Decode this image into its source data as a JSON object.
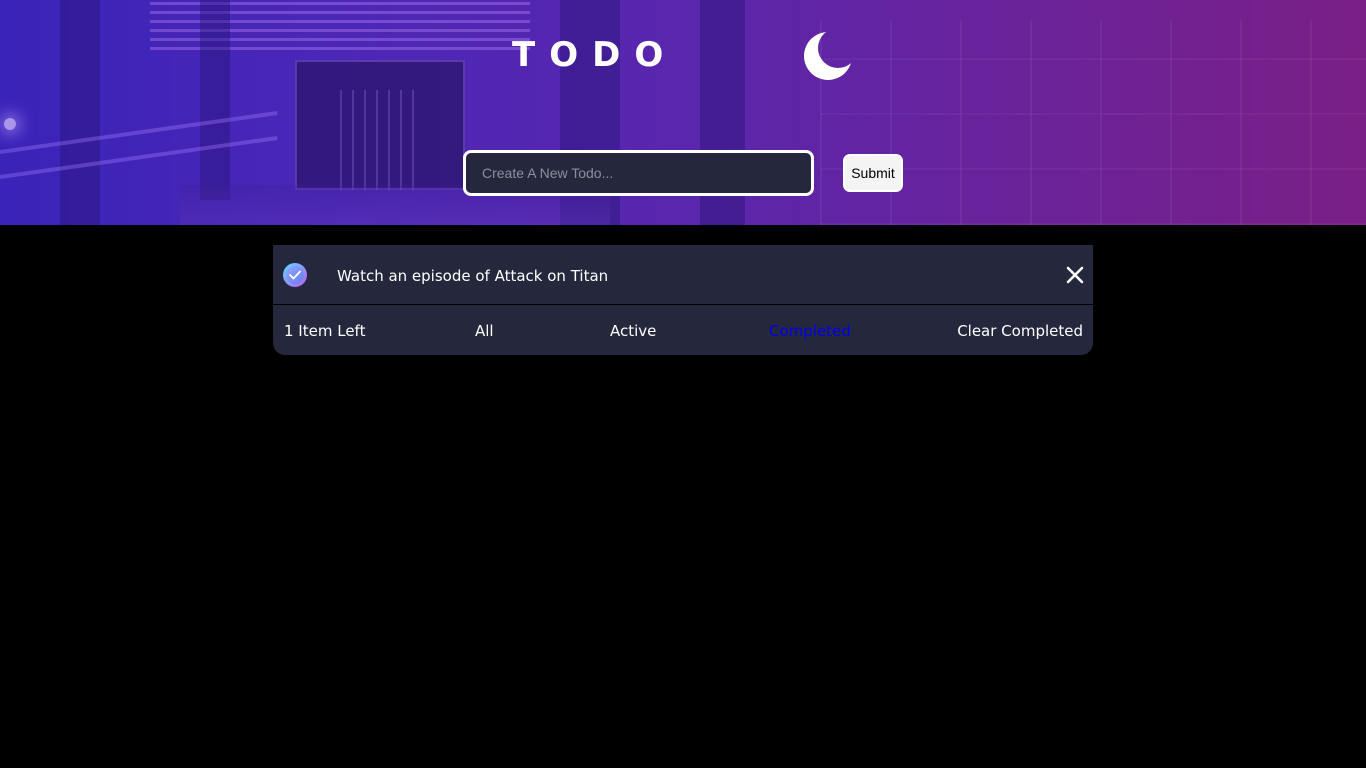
{
  "header": {
    "title": "TODO",
    "theme_toggle_icon": "moon-icon"
  },
  "new_todo": {
    "placeholder": "Create A New Todo...",
    "value": "",
    "submit_label": "Submit"
  },
  "todos": [
    {
      "text": "Watch an episode of Attack on Titan",
      "completed": true,
      "check_icon": "check-circle-icon",
      "delete_icon": "close-icon"
    }
  ],
  "footer": {
    "items_left": "1 Item Left",
    "filters": {
      "all": "All",
      "active": "Active",
      "completed": "Completed"
    },
    "selected_filter": "Completed",
    "clear_completed": "Clear Completed"
  },
  "colors": {
    "background": "#000000",
    "card": "#25273c",
    "selected_filter": "#0000ee",
    "text": "#ffffff"
  }
}
